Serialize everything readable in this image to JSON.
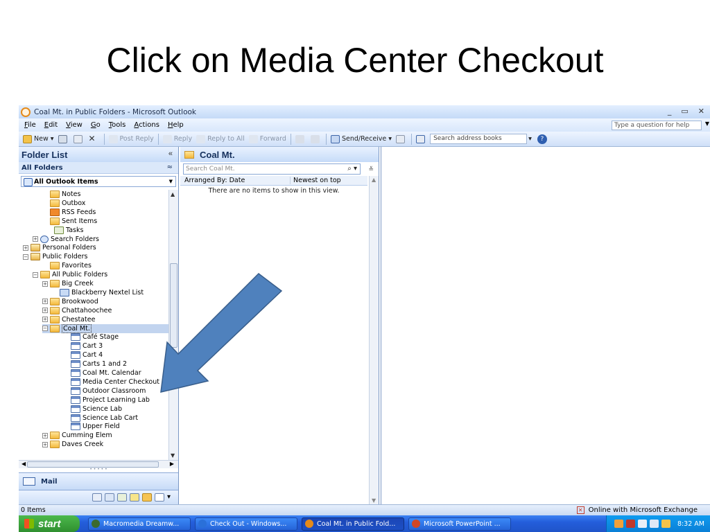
{
  "slide": {
    "title": "Click on Media Center Checkout"
  },
  "window": {
    "title": "Coal Mt. in Public Folders - Microsoft Outlook",
    "controls": [
      "_",
      "▭",
      "✕"
    ]
  },
  "menubar": {
    "items": [
      {
        "u": "F",
        "rest": "ile"
      },
      {
        "u": "E",
        "rest": "dit"
      },
      {
        "u": "V",
        "rest": "iew"
      },
      {
        "u": "G",
        "rest": "o"
      },
      {
        "u": "T",
        "rest": "ools"
      },
      {
        "u": "A",
        "rest": "ctions"
      },
      {
        "u": "H",
        "rest": "elp"
      }
    ],
    "question_placeholder": "Type a question for help"
  },
  "toolbar": {
    "new": "New",
    "post_reply": "Post Reply",
    "reply": "Reply",
    "reply_all": "Reply to All",
    "forward": "Forward",
    "send_receive": "Send/Receive",
    "address_placeholder": "Search address books"
  },
  "nav": {
    "title": "Folder List",
    "all_folders": "All Folders",
    "dropdown": "All Outlook Items",
    "tree": [
      {
        "label": "Notes",
        "icon": "folder",
        "indent": 2,
        "expander": ""
      },
      {
        "label": "Outbox",
        "icon": "folder",
        "indent": 2,
        "expander": ""
      },
      {
        "label": "RSS Feeds",
        "icon": "rss",
        "indent": 2,
        "expander": ""
      },
      {
        "label": "Sent Items",
        "icon": "folder",
        "indent": 2,
        "expander": ""
      },
      {
        "label": "Tasks",
        "icon": "task",
        "indent": 2,
        "expander": ""
      },
      {
        "label": "Search Folders",
        "icon": "search",
        "indent": 1,
        "expander": "+"
      },
      {
        "label": "Personal Folders",
        "icon": "pfolder",
        "indent": 0,
        "expander": "+"
      },
      {
        "label": "Public Folders",
        "icon": "pfolder",
        "indent": 0,
        "expander": "−"
      },
      {
        "label": "Favorites",
        "icon": "folder",
        "indent": 2,
        "expander": ""
      },
      {
        "label": "All Public Folders",
        "icon": "folder",
        "indent": 1,
        "expander": "−"
      },
      {
        "label": "Big Creek",
        "icon": "folder",
        "indent": 2,
        "expander": "+"
      },
      {
        "label": "Blackberry Nextel List",
        "icon": "contact",
        "indent": 3,
        "expander": ""
      },
      {
        "label": "Brookwood",
        "icon": "folder",
        "indent": 2,
        "expander": "+"
      },
      {
        "label": "Chattahoochee",
        "icon": "folder",
        "indent": 2,
        "expander": "+"
      },
      {
        "label": "Chestatee",
        "icon": "folder",
        "indent": 2,
        "expander": "+"
      },
      {
        "label": "Coal Mt.",
        "icon": "folder",
        "indent": 2,
        "expander": "−",
        "selected": true
      },
      {
        "label": "Café Stage",
        "icon": "cal",
        "indent": 4,
        "expander": ""
      },
      {
        "label": "Cart 3",
        "icon": "cal",
        "indent": 4,
        "expander": ""
      },
      {
        "label": "Cart 4",
        "icon": "cal",
        "indent": 4,
        "expander": ""
      },
      {
        "label": "Carts 1 and 2",
        "icon": "cal",
        "indent": 4,
        "expander": ""
      },
      {
        "label": "Coal Mt. Calendar",
        "icon": "cal",
        "indent": 4,
        "expander": ""
      },
      {
        "label": "Media Center Checkout",
        "icon": "cal",
        "indent": 4,
        "expander": ""
      },
      {
        "label": "Outdoor Classroom",
        "icon": "cal",
        "indent": 4,
        "expander": ""
      },
      {
        "label": "Project Learning Lab",
        "icon": "cal",
        "indent": 4,
        "expander": ""
      },
      {
        "label": "Science Lab",
        "icon": "cal",
        "indent": 4,
        "expander": ""
      },
      {
        "label": "Science Lab Cart",
        "icon": "cal",
        "indent": 4,
        "expander": ""
      },
      {
        "label": "Upper Field",
        "icon": "cal",
        "indent": 4,
        "expander": ""
      },
      {
        "label": "Cumming Elem",
        "icon": "folder",
        "indent": 2,
        "expander": "+"
      },
      {
        "label": "Daves Creek",
        "icon": "folder",
        "indent": 2,
        "expander": "+"
      }
    ],
    "mail_button": "Mail"
  },
  "middle": {
    "title": "Coal Mt.",
    "search_placeholder": "Search Coal Mt.",
    "arranged_by": "Arranged By: Date",
    "sort_order": "Newest on top",
    "empty_message": "There are no items to show in this view."
  },
  "status": {
    "items": "0 Items",
    "connection": "Online with Microsoft Exchange"
  },
  "taskbar": {
    "start": "start",
    "tasks": [
      {
        "label": "Macromedia Dreamw...",
        "color": "#3c6a2f"
      },
      {
        "label": "Check Out - Windows...",
        "color": "#2a70d9"
      },
      {
        "label": "Coal Mt. in Public Fold...",
        "color": "#e58a1a",
        "active": true
      },
      {
        "label": "Microsoft PowerPoint ...",
        "color": "#d24726"
      }
    ],
    "clock": "8:32 AM"
  },
  "colors": {
    "arrow_fill": "#4f81bd",
    "arrow_stroke": "#385d8a"
  }
}
